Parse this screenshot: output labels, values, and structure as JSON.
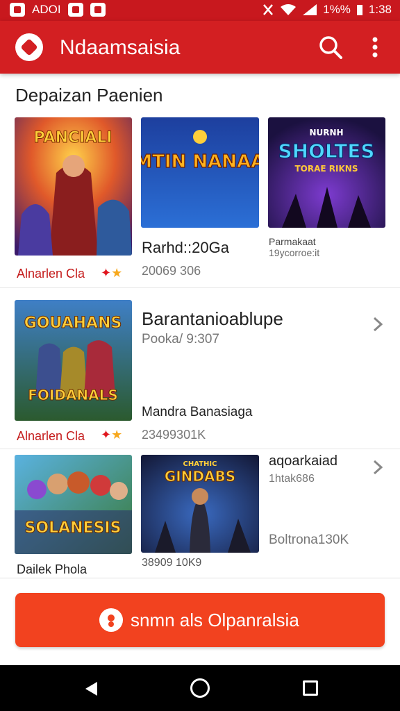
{
  "status_bar": {
    "left_text": "ADOI",
    "battery": "1%%",
    "time": "1:38"
  },
  "app_bar": {
    "title": "Ndaamsaisia"
  },
  "section": {
    "title": "Depaizan Paenien"
  },
  "cards": [
    {
      "id": "card-1",
      "art_title": "PANCIALI",
      "developer": "Alnarlen Cla",
      "rating_stars": 2
    },
    {
      "id": "card-2",
      "art_title": "WEMTIN NANAALIN",
      "name": "Rarhd::20Ga",
      "meta": "20069 306"
    },
    {
      "id": "card-3",
      "art_title": "SHOLTES",
      "art_subtitle": "TORAE RIKNS",
      "art_pre": "NURNH",
      "name": "Parmakaat",
      "sub": "19ycorroe:it"
    },
    {
      "id": "card-4",
      "art_title": "GOUAHANS",
      "art_subtitle": "FOIDANALS",
      "title": "Barantanioablupe",
      "subtitle": "Pooka/ 9:307",
      "name": "Mandra Banasiaga",
      "meta": "23499301K",
      "developer": "Alnarlen Cla",
      "rating_stars": 2
    },
    {
      "id": "card-5",
      "art_title": "SOLANESIS",
      "developer": "Dailek Phola"
    },
    {
      "id": "card-6",
      "art_title": "GINDABS",
      "art_pre": "CHATHIC",
      "meta": "38909 10K9",
      "title": "aqoarkaiad",
      "sub": "1htak686",
      "meta2": "Boltrona130K"
    }
  ],
  "cta": {
    "label": "snmn als Olpanralsia",
    "color": "#f2421f"
  },
  "colors": {
    "brand": "#d31f22",
    "status_bar": "#c8181e",
    "accent_text": "#c41a1a",
    "star": "#f7a81c"
  },
  "icons": {
    "app_logo": "app-logo-icon",
    "search": "search-icon",
    "menu": "more-vert-icon",
    "chevron": "chevron-right-icon",
    "nav_back": "back-triangle-icon",
    "nav_home": "home-circle-icon",
    "nav_recent": "recents-square-icon"
  }
}
